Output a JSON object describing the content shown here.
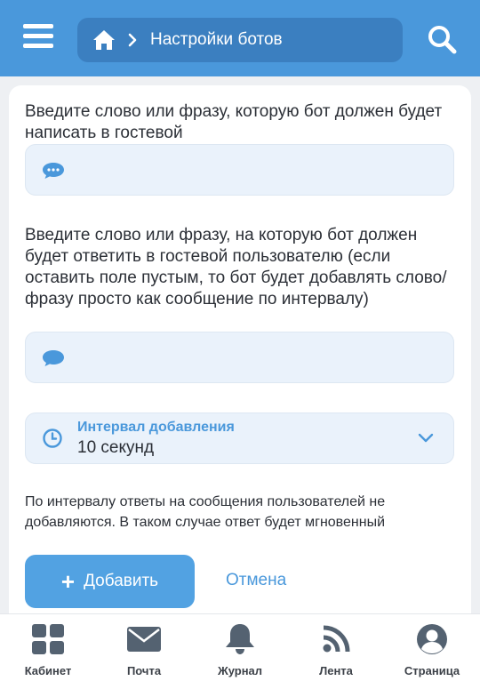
{
  "header": {
    "title": "Настройки ботов",
    "icons": {
      "menu": "hamburger-menu-icon",
      "home": "home-icon",
      "breadcrumb_separator": "chevron-right-icon",
      "search": "search-icon"
    }
  },
  "form": {
    "phrase_label": "Введите слово или фразу, которую бот должен будет написать в гостевой",
    "phrase_value": "",
    "trigger_label": "Введите слово или фразу, на которую бот должен будет ответить в гостевой пользователю (если оставить поле пустым, то бот будет добавлять слово/фразу просто как сообщение по интервалу)",
    "trigger_value": "",
    "interval": {
      "label": "Интервал добавления",
      "value": "10 секунд"
    },
    "note": "По интервалу ответы на сообщения пользователей не добавляются. В таком случае ответ будет мгновенный",
    "add_label": "Добавить",
    "cancel_label": "Отмена"
  },
  "bottom_nav": {
    "items": [
      {
        "label": "Кабинет",
        "icon": "grid-icon"
      },
      {
        "label": "Почта",
        "icon": "mail-icon"
      },
      {
        "label": "Журнал",
        "icon": "bell-icon"
      },
      {
        "label": "Лента",
        "icon": "rss-icon"
      },
      {
        "label": "Страница",
        "icon": "user-icon"
      }
    ]
  },
  "colors": {
    "header_bg": "#4a98db",
    "breadcrumb_bg": "#3b7fc0",
    "accent": "#4a98db",
    "field_bg": "#eaf2fb",
    "button_bg": "#52a2e2",
    "nav_icon": "#546271"
  }
}
